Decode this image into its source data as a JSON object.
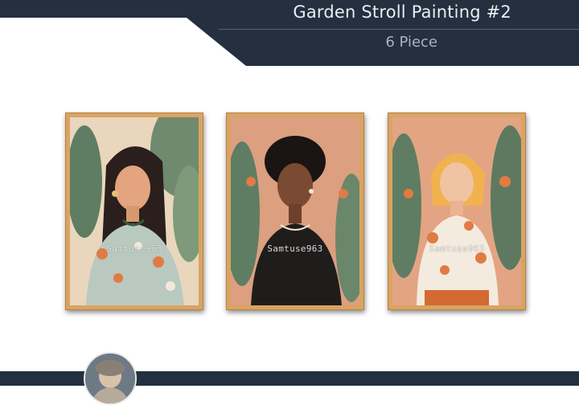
{
  "header": {
    "title": "Garden Stroll Painting #2",
    "subtitle": "6 Piece",
    "band_color": "#243040"
  },
  "paintings": [
    {
      "watermark": "Samtuse963",
      "subject": "woman with dark wavy hair, floral sage blouse"
    },
    {
      "watermark": "Samtuse963",
      "subject": "woman with short curly hair, black top"
    },
    {
      "watermark": "Samtuse963",
      "subject": "woman with blonde bob, floral white blouse"
    }
  ],
  "colors": {
    "frame": "#d9a463",
    "bottom_bar": "#233040"
  },
  "footer": {
    "avatar_icon": "user-avatar-icon"
  }
}
